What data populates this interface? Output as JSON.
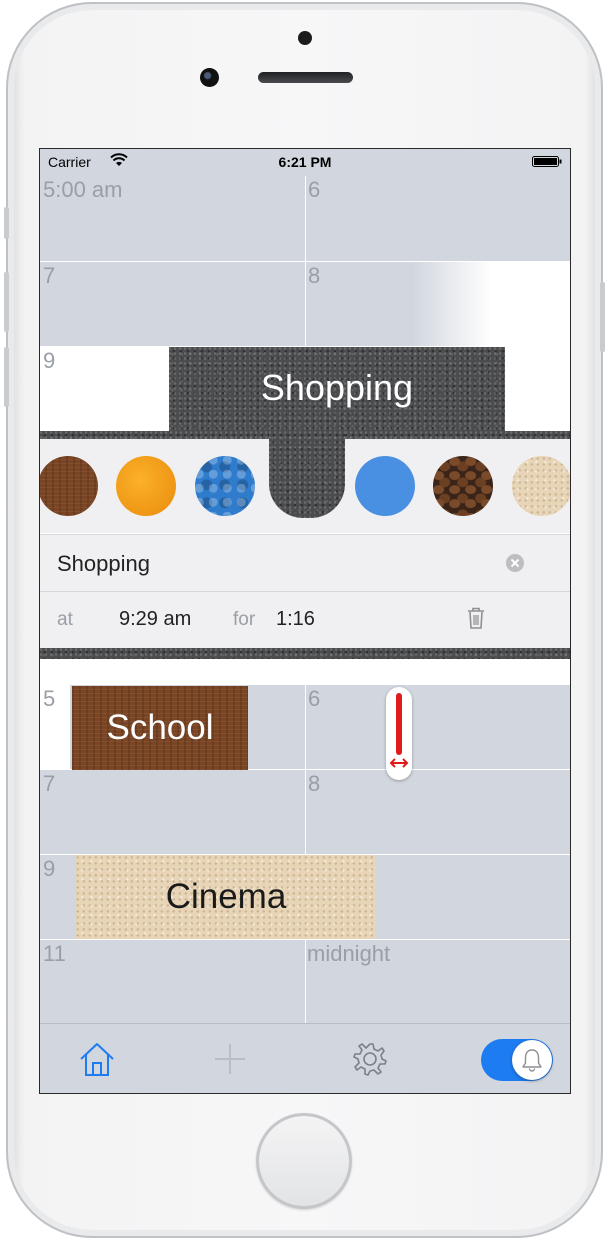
{
  "status_bar": {
    "carrier": "Carrier",
    "time": "6:21 PM"
  },
  "top_grid": {
    "row1": {
      "left": "5:00 am",
      "right": "6"
    },
    "row2": {
      "left": "7",
      "right": "8"
    },
    "row3": {
      "left": "9"
    }
  },
  "editor": {
    "title": "Shopping",
    "name_value": "Shopping",
    "at_label": "at",
    "at_value": "9:29 am",
    "for_label": "for",
    "for_value": "1:16",
    "swatches": [
      "wood",
      "orange",
      "blue-bubbles",
      "asphalt",
      "blue",
      "coffee",
      "paper"
    ]
  },
  "bottom_grid": {
    "row1": {
      "left": "5",
      "right": "6"
    },
    "row2": {
      "left": "7",
      "right": "8"
    },
    "row3": {
      "left": "9"
    },
    "row4": {
      "left": "11",
      "right": "midnight"
    },
    "events": {
      "school": "School",
      "cinema": "Cinema"
    }
  },
  "tab_bar": {
    "icons": [
      "home-icon",
      "add-icon",
      "settings-icon",
      "bell-icon"
    ],
    "accent": "#1e7cf2",
    "reminder_toggle": "on"
  },
  "colors": {
    "grid": "#d2d7df",
    "accent": "#1e7cf2",
    "resize_handle": "#e01b1b"
  }
}
